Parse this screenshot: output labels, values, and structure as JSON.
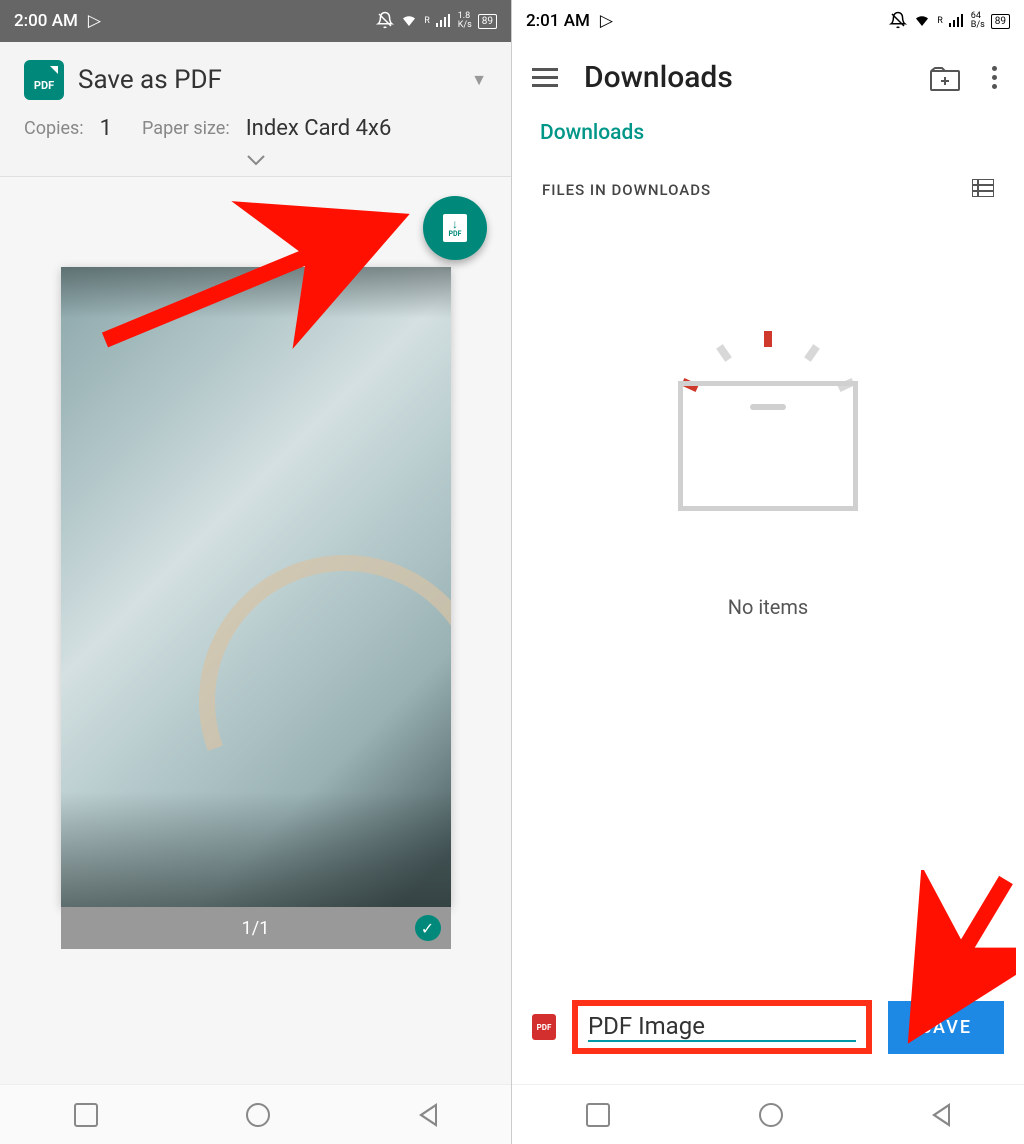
{
  "left": {
    "status": {
      "time": "2:00 AM",
      "speed": "1.8\nK/s",
      "battery": "89"
    },
    "header": {
      "title": "Save as PDF",
      "copies_label": "Copies:",
      "copies_value": "1",
      "paper_label": "Paper size:",
      "paper_value": "Index Card 4x6"
    },
    "fab": {
      "icon_label": "PDF"
    },
    "preview": {
      "page_indicator": "1/1"
    }
  },
  "right": {
    "status": {
      "time": "2:01 AM",
      "speed": "64\nB/s",
      "battery": "89"
    },
    "header": {
      "title": "Downloads"
    },
    "breadcrumb": "Downloads",
    "section_label": "FILES IN DOWNLOADS",
    "empty_text": "No items",
    "save_bar": {
      "pdf_icon_label": "PDF",
      "filename": "PDF Image",
      "button": "SAVE"
    }
  },
  "icons": {
    "play_store": "▷",
    "dnd": "🔕",
    "roaming": "R"
  }
}
